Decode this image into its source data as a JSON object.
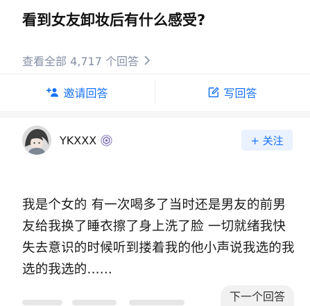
{
  "question": {
    "title": "看到女友卸妆后有什么感受?",
    "view_all": "查看全部 4,717 个回答"
  },
  "actions": {
    "invite_label": "邀请回答",
    "write_label": "写回答"
  },
  "author": {
    "name": "YKXXX",
    "follow_label": "+ 关注"
  },
  "answer": {
    "text": "我是个女的 有一次喝多了当时还是男友的前男友给我换了睡衣擦了身上洗了脸 一切就绪我快失去意识的时候听到搂着我的他小声说我选的我选的我选的......"
  },
  "footer": {
    "next_label": "下一个回答"
  },
  "colors": {
    "accent": "#1772f6",
    "muted": "#8590a6",
    "follow_bg": "#eaf2ff"
  }
}
